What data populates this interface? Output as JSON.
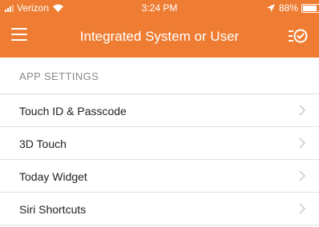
{
  "status_bar": {
    "carrier": "Verizon",
    "time": "3:24 PM",
    "battery": "88%",
    "battery_level": 0.88,
    "icons": [
      "signal-icon",
      "wifi-icon",
      "location-arrow-icon",
      "battery-icon"
    ]
  },
  "nav": {
    "title": "Integrated System or User",
    "left_icon": "hamburger-menu-icon",
    "right_icon": "filter-check-icon",
    "background": "#ee7d33"
  },
  "section": {
    "header": "APP SETTINGS"
  },
  "rows": [
    {
      "label": "Touch ID & Passcode"
    },
    {
      "label": "3D Touch"
    },
    {
      "label": "Today Widget"
    },
    {
      "label": "Siri Shortcuts"
    }
  ]
}
